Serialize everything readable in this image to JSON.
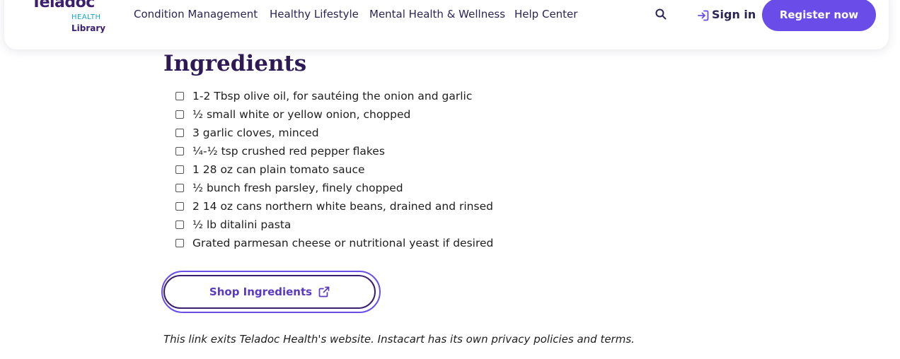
{
  "header": {
    "logo": {
      "name": "Teladoc",
      "sub1": "HEALTH",
      "sub2": "Library",
      "reg": "®"
    },
    "nav": [
      {
        "label": "Condition Management"
      },
      {
        "label": "Healthy Lifestyle"
      },
      {
        "label": "Mental Health & Wellness"
      },
      {
        "label": "Help Center"
      }
    ],
    "search_icon": "search-icon",
    "sign_in_label": "Sign in",
    "register_label": "Register now"
  },
  "main": {
    "heading": "Ingredients",
    "ingredients": [
      "1-2 Tbsp olive oil, for sautéing the onion and garlic",
      "½ small white or yellow onion, chopped",
      "3 garlic cloves, minced",
      "¼-½ tsp crushed red pepper flakes",
      "1 28 oz can plain tomato sauce",
      "½ bunch fresh parsley, finely chopped",
      "2 14 oz cans northern white beans, drained and rinsed",
      "½ lb ditalini pasta",
      "Grated parmesan cheese or nutritional yeast if desired"
    ],
    "shop_button_label": "Shop Ingredients",
    "disclaimer": "This link exits Teladoc Health's website. Instacart has its own privacy policies and terms."
  },
  "colors": {
    "brand_purple": "#6a4de8",
    "dark_purple": "#3b1f6e",
    "teal": "#17a8c4"
  }
}
